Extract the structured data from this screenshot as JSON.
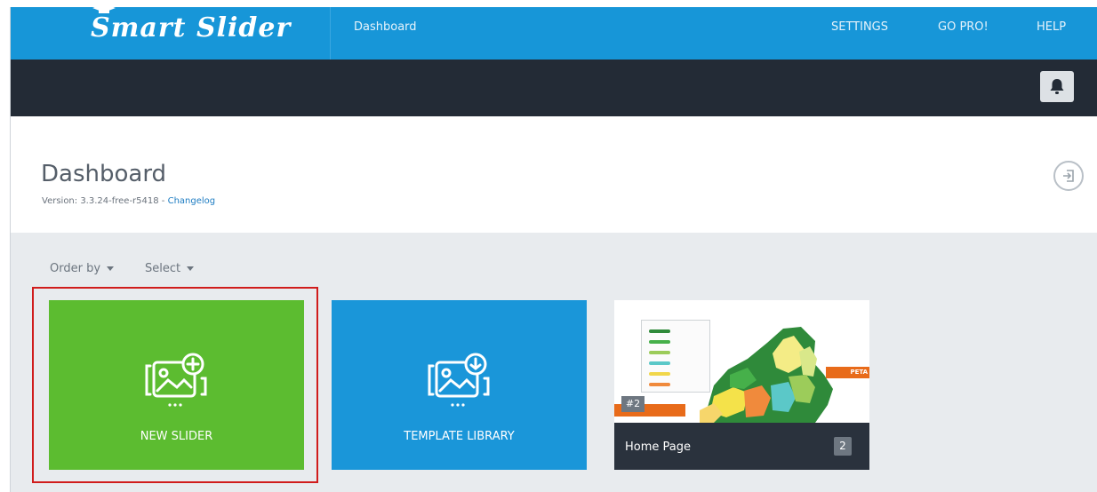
{
  "topbar": {
    "logo_text": "Smart Slider",
    "nav_dashboard": "Dashboard",
    "nav_settings": "SETTINGS",
    "nav_gopro": "GO PRO!",
    "nav_help": "HELP"
  },
  "header": {
    "title": "Dashboard",
    "version_text": "Version: 3.3.24-free-r5418 - ",
    "changelog_link": "Changelog"
  },
  "filters": {
    "order_by": "Order by",
    "select": "Select"
  },
  "tiles": {
    "new_slider": "NEW SLIDER",
    "template_library": "TEMPLATE LIBRARY"
  },
  "slider_card": {
    "title": "Home Page",
    "slide_count": "2",
    "thumb_badge": "#2",
    "thumb_label": "PETA"
  },
  "colors": {
    "topbar": "#1796d8",
    "darkbar": "#232b36",
    "new_slider_tile": "#5cbc30",
    "template_tile": "#1a96d9",
    "highlight": "#d01c1c"
  },
  "icons": [
    "graduation-cap-icon",
    "bell-icon",
    "exit-icon",
    "add-image-icon",
    "download-image-icon",
    "caret-down-icon"
  ]
}
